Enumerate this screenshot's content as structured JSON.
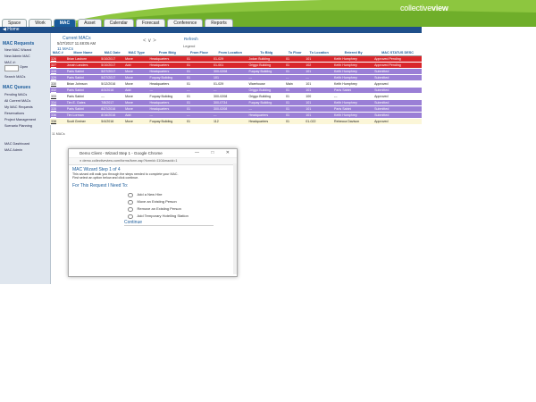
{
  "app": {
    "logo_a": "collective",
    "logo_b": "view",
    "home_label": "Home"
  },
  "tabs": [
    "Space",
    "Work",
    "MAC",
    "Asset",
    "Calendar",
    "Forecast",
    "Conference",
    "Reports"
  ],
  "active_tab": "MAC",
  "sidebar": {
    "requests_heading": "MAC Requests",
    "request_items": [
      "New MAC Wizard",
      "New Admin MAC",
      "MAC #:"
    ],
    "open_label": "Open",
    "search_label": "Search MACs",
    "queues_heading": "MAC Queues",
    "queue_items": [
      "Pending MACs",
      "All Current MACs",
      "My MAC Requests",
      "Reservations",
      "Project Management",
      "Scenario Planning"
    ],
    "bottom_items": [
      "MAC Dashboard",
      "MAC Admin"
    ]
  },
  "main": {
    "title": "Current MACs",
    "date": "5/27/2017 11:48:05 AM",
    "count_label": "11 MACs",
    "nav_glyphs": "<  ∨  >",
    "refresh_label": "Refresh",
    "legend_label": "Legend",
    "footer_count": "11 MACs"
  },
  "table": {
    "headers": [
      "MAC #",
      "Move Name",
      "MAC Date",
      "MAC Type",
      "From Bldg",
      "From Floor",
      "From Location",
      "To Bldg",
      "To Floor",
      "To Location",
      "Entered By",
      "MAC STATUS DESC"
    ],
    "rows": [
      {
        "style": "red",
        "cells": [
          "326",
          "Brian Lasborn",
          "5/10/2017",
          "Move",
          "Headquarters",
          "01",
          "01-029",
          "Jodan Building",
          "01",
          "101",
          "Keith Humphrey",
          "Approved Pending"
        ]
      },
      {
        "style": "red",
        "cells": [
          "327",
          "Jonah Landers",
          "5/10/2017",
          "Add",
          "Headquarters",
          "01",
          "01-001",
          "Origgo Building",
          "01",
          "102",
          "Keith Humphrey",
          "Approved Pending"
        ]
      },
      {
        "style": "purple",
        "cells": [
          "328",
          "Paris Sabini",
          "5/27/2017",
          "Move",
          "Headquarters",
          "01",
          "300-0208",
          "Fuquay Building",
          "01",
          "101",
          "Keith Humphrey",
          "Submitted"
        ]
      },
      {
        "style": "purple",
        "cells": [
          "329",
          "Paris Sabini",
          "5/27/2017",
          "Move",
          "Fuquay Building",
          "01",
          "101",
          "---",
          "---",
          "---",
          "Keith Humphrey",
          "Submitted"
        ]
      },
      {
        "style": "white",
        "cells": [
          "330",
          "Brian Johnson",
          "5/12/2016",
          "Move",
          "Headquarters",
          "01",
          "01-029",
          "Warehouse",
          "Main",
          "101",
          "Keith Humphrey",
          "Approved"
        ]
      },
      {
        "style": "purple",
        "cells": [
          "332",
          "Paris Sabini",
          "8/3/2016",
          "Add",
          "---",
          "---",
          "---",
          "Origgo Building",
          "01",
          "101",
          "Paris Sabini",
          "Submitted"
        ]
      },
      {
        "style": "white",
        "cells": [
          "333",
          "Paris Sabini",
          "---",
          "Move",
          "Fuquay Building",
          "01",
          "300-0208",
          "Origgo Building",
          "01",
          "100",
          "---",
          "Approved"
        ]
      },
      {
        "style": "purple",
        "cells": [
          "334",
          "Tim E. Gates",
          "7/8/2017",
          "Move",
          "Headquarters",
          "01",
          "300-0734",
          "Fuquay Building",
          "01",
          "101",
          "Keith Humphrey",
          "Submitted"
        ]
      },
      {
        "style": "purple",
        "cells": [
          "335",
          "Paris Sabini",
          "8/27/2016",
          "Move",
          "Headquarters",
          "01",
          "300-0208",
          "---",
          "01",
          "101",
          "Paris Sabini",
          "Submitted"
        ]
      },
      {
        "style": "purple",
        "cells": [
          "336",
          "Tim Lorman",
          "8/16/2016",
          "Add",
          "---",
          "---",
          "---",
          "Headquarters",
          "01",
          "101",
          "Keith Humphrey",
          "Submitted"
        ]
      },
      {
        "style": "cream",
        "cells": [
          "338",
          "Scott Greiner",
          "5/4/2016",
          "Move",
          "Fuquay Building",
          "01",
          "112",
          "Headquarters",
          "01",
          "01-022",
          "Rebecca Davison",
          "Approved"
        ]
      }
    ]
  },
  "dialog": {
    "window_title": "Demo Client - Wizard Step 1 - Google Chrome",
    "window_controls": "—  □  ✕",
    "url": "demo.collectiveview.com/forms/form.asp?formid=110&macid=1",
    "heading": "MAC Wizard Step 1 of 4",
    "desc1": "This wizard will walk you through the steps needed to complete your MAC.",
    "desc2": "First select an option below and click continue.",
    "question": "For This Request I Need To:",
    "options": [
      "Add a New Hire",
      "Move an Existing Person",
      "Remove an Existing Person",
      "Add Temporary Hotelling Station"
    ],
    "continue_label": "Continue"
  },
  "colors": {
    "brand_green": "#8dc63f",
    "nav_blue": "#1f4f8a",
    "pending_red": "#d9262b",
    "submitted_purple": "#9a7fd6",
    "approved_cream": "#fbf6d8"
  }
}
